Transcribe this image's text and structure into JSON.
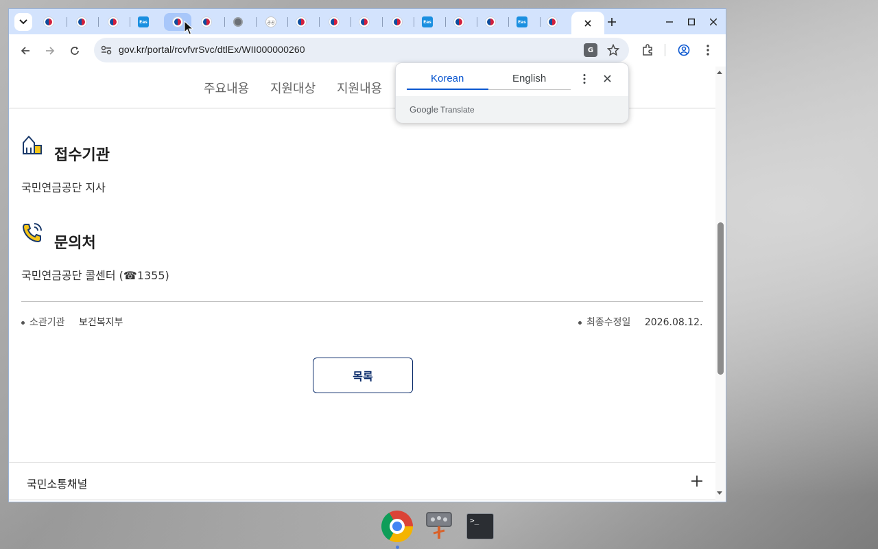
{
  "browser": {
    "url": "gov.kr/portal/rcvfvrSvc/dtlEx/WII000000260",
    "tabs": [
      {
        "favicon": "korea-gov-icon"
      },
      {
        "favicon": "korea-gov-icon"
      },
      {
        "favicon": "korea-gov-icon"
      },
      {
        "favicon": "blue-app-icon"
      },
      {
        "favicon": "korea-gov-icon"
      },
      {
        "favicon": "korea-gov-icon"
      },
      {
        "favicon": "globe-icon"
      },
      {
        "favicon": "gray-logo-icon"
      },
      {
        "favicon": "korea-gov-icon"
      },
      {
        "favicon": "korea-gov-icon"
      },
      {
        "favicon": "korea-gov-icon"
      },
      {
        "favicon": "korea-gov-icon"
      },
      {
        "favicon": "blue-app-icon"
      },
      {
        "favicon": "korea-gov-icon"
      },
      {
        "favicon": "korea-gov-icon"
      },
      {
        "favicon": "blue-app-icon"
      },
      {
        "favicon": "korea-gov-icon"
      }
    ],
    "blue_app_label": "Eas",
    "gray_logo_label": "공공"
  },
  "translate": {
    "source_lang": "Korean",
    "target_lang": "English",
    "brand": "Google Translate",
    "brand_google": "Google",
    "brand_translate": "Translate"
  },
  "page": {
    "subnav": [
      "주요내용",
      "지원대상",
      "지원내용"
    ],
    "sections": [
      {
        "title": "접수기관",
        "body": "국민연금공단 지사",
        "icon": "building-icon"
      },
      {
        "title": "문의처",
        "body": "국민연금공단 콜센터 (☎1355)",
        "icon": "phone-icon"
      }
    ],
    "meta": {
      "agency_label": "소관기관",
      "agency_value": "보건복지부",
      "updated_label": "최종수정일",
      "updated_value": "2026.08.12."
    },
    "list_button": "목록",
    "footer_channel": "국민소통채널"
  },
  "taskbar": {
    "terminal_prompt": ">_"
  },
  "colors": {
    "tabstrip": "#d3e3fd",
    "accent_blue": "#0b57d0",
    "gov_navy": "#0b2c6b"
  }
}
